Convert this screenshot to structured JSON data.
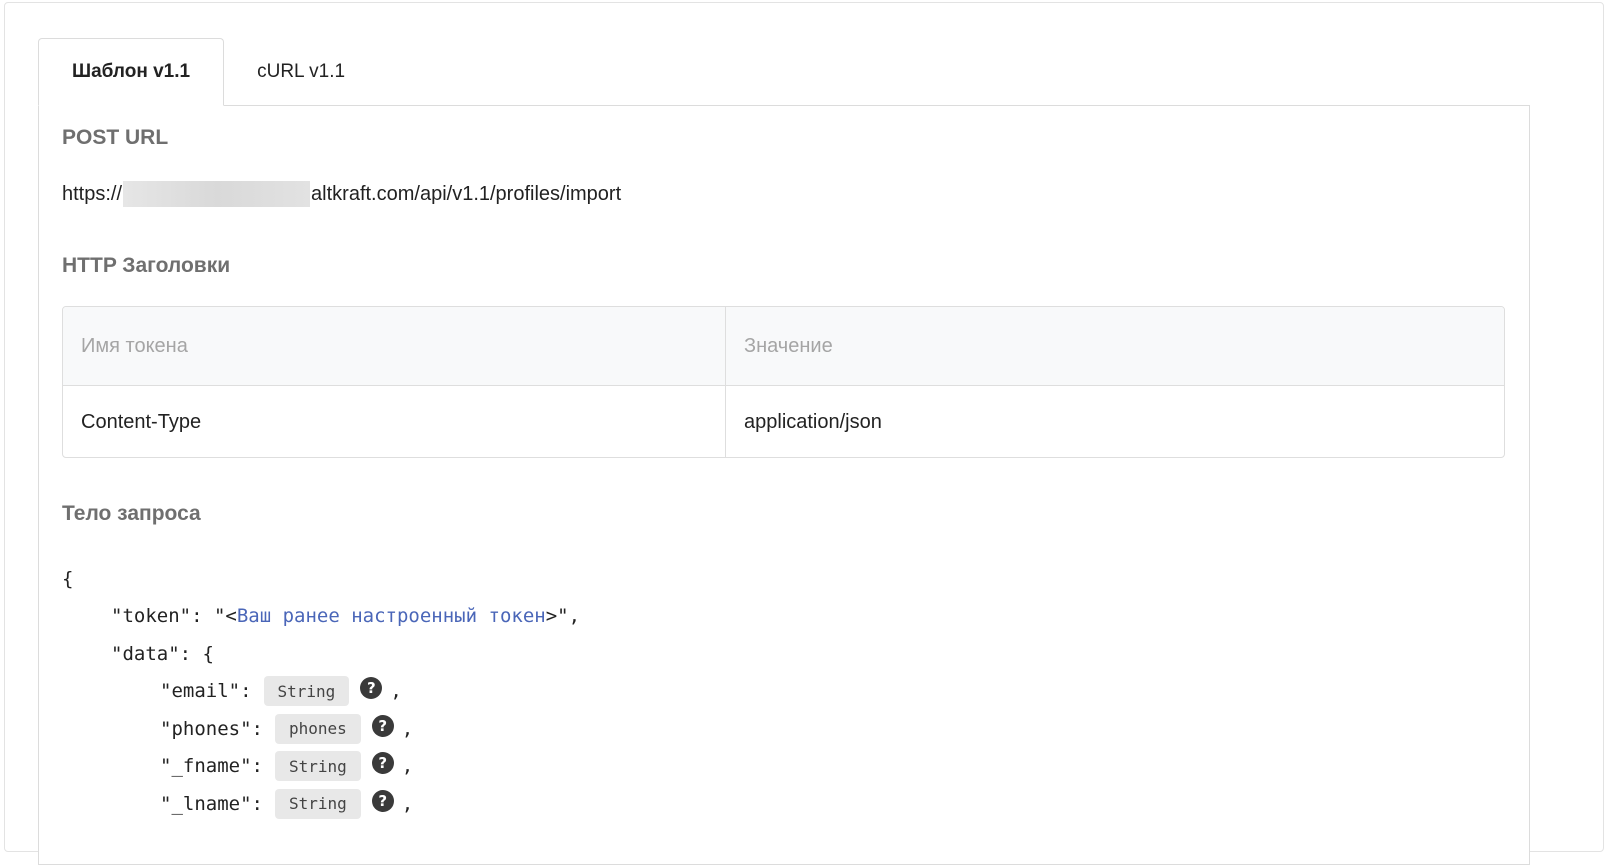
{
  "tabs": [
    {
      "label": "Шаблон v1.1",
      "active": true
    },
    {
      "label": "cURL v1.1",
      "active": false
    }
  ],
  "post_url": {
    "title": "POST URL",
    "prefix": "https://",
    "suffix": "altkraft.com/api/v1.1/profiles/import"
  },
  "headers": {
    "title": "HTTP Заголовки",
    "columns": [
      "Имя токена",
      "Значение"
    ],
    "rows": [
      {
        "name": "Content-Type",
        "value": "application/json"
      }
    ]
  },
  "body": {
    "title": "Тело запроса",
    "open_brace": "{",
    "token_key": "\"token\": \"<",
    "token_placeholder": "Ваш ранее настроенный токен",
    "token_end": ">\",",
    "data_key": "\"data\": {",
    "fields": [
      {
        "key": "\"email\":",
        "type": "String",
        "comma": ","
      },
      {
        "key": "\"phones\":",
        "type": "phones",
        "comma": ","
      },
      {
        "key": "\"_fname\":",
        "type": "String",
        "comma": ","
      },
      {
        "key": "\"_lname\":",
        "type": "String",
        "comma": ","
      }
    ]
  },
  "icons": {
    "help": "?"
  }
}
